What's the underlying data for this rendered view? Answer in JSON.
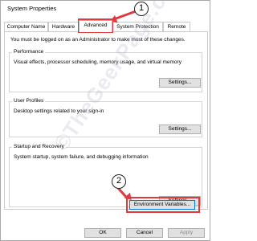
{
  "window": {
    "title": "System Properties"
  },
  "tabs": [
    {
      "label": "Computer Name"
    },
    {
      "label": "Hardware"
    },
    {
      "label": "Advanced"
    },
    {
      "label": "System Protection"
    },
    {
      "label": "Remote"
    }
  ],
  "notice": "You must be logged on as an Administrator to make most of these changes.",
  "performance": {
    "label": "Performance",
    "description": "Visual effects, processor scheduling, memory usage, and virtual memory",
    "button": "Settings..."
  },
  "user_profiles": {
    "label": "User Profiles",
    "description": "Desktop settings related to your sign-in",
    "button": "Settings..."
  },
  "startup_recovery": {
    "label": "Startup and Recovery",
    "description": "System startup, system failure, and debugging information",
    "button": "Settings..."
  },
  "env_button": "Environment Variables...",
  "footer": {
    "ok": "OK",
    "cancel": "Cancel",
    "apply": "Apply"
  },
  "annotations": {
    "step1": "1",
    "step2": "2",
    "accent": "#e0393e"
  },
  "watermark": "©TheGeekPage.com"
}
